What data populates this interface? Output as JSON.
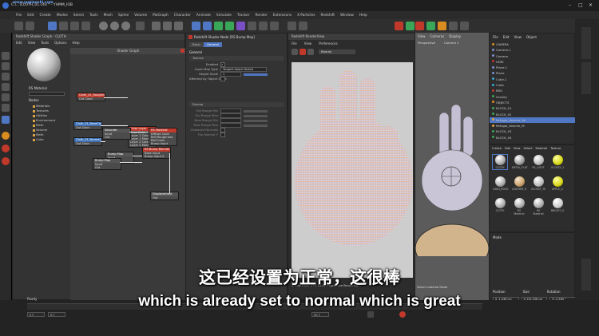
{
  "window": {
    "title": "C:\\...\\CLOTH_01.c4d * - YHMM_IOB",
    "watermark": "www.yugiaoshi.com",
    "node_space_label": "Node Space:",
    "node_space_value": "Current (Redshift)",
    "layout_label": "Layout:",
    "layout_value": "RS_S17 (User)"
  },
  "menu": [
    "File",
    "Edit",
    "Create",
    "Modes",
    "Select",
    "Tools",
    "Mesh",
    "Spline",
    "Volume",
    "MoGraph",
    "Character",
    "Animate",
    "Simulate",
    "Tracker",
    "Render",
    "Extensions",
    "X-Particles",
    "Redshift",
    "Window",
    "Help"
  ],
  "colors": {
    "accent": "#4f77c4",
    "selected_red": "#c0392b",
    "panel_bg": "#333333",
    "subtitle": "#ffffff"
  },
  "material_panel": {
    "title": "Redshift Shader Graph - CLOTH",
    "tabs": [
      "Edit",
      "View",
      "Tools",
      "Options",
      "Help"
    ],
    "material_name": "RS Material",
    "nodes_header": "Nodes",
    "tree": [
      "Materials",
      "Textures",
      "Utilities",
      "Environment",
      "Math",
      "Volume",
      "Math",
      "Color"
    ]
  },
  "shader_graph": {
    "title": "Shader Graph",
    "nodes": [
      {
        "title": "Cloth_01_Roughness.jpg",
        "rows": [
          "Out Color"
        ]
      },
      {
        "title": "Color Layer",
        "rows": [
          "Base Color",
          "Layer 1 Color",
          "Layer 1 Mask",
          "Layer 2 Color",
          "Layer 2 Mask"
        ]
      },
      {
        "title": "Cloth_01_BaseColor.jpg",
        "rows": [
          "Out Color"
        ]
      },
      {
        "title": "Saturate",
        "rows": [
          "Input",
          "Out"
        ]
      },
      {
        "title": "RS Material",
        "rows": [
          "Diffuse Color",
          "Refl Roughness",
          "Refl Color",
          "Bump Input"
        ]
      },
      {
        "title": "Cloth_01_Normal.jpg",
        "rows": [
          "Out Color"
        ]
      },
      {
        "title": "Bump Map",
        "rows": [
          "Input",
          "Out"
        ]
      },
      {
        "title": "RS Bump Blender",
        "rows": [
          "Base Input",
          "Bump Input 0"
        ]
      },
      {
        "title": "Bump Map",
        "rows": [
          "Input",
          "Out"
        ]
      },
      {
        "title": "Displacement",
        "rows": [
          "Out"
        ]
      }
    ]
  },
  "attributes": {
    "header": "Redshift Shader Node [RS Bump Map]",
    "tabs": [
      "Basic",
      "General"
    ],
    "section_general": "General",
    "section_texture": "Texture",
    "section_remap": "Remap",
    "rows": [
      {
        "label": "Enabled",
        "value": "✓"
      },
      {
        "label": "Input Map Type",
        "value": "Tangent-Space Normal"
      },
      {
        "label": "Height Scale",
        "value": "1"
      },
      {
        "label": "Affected by Object Scale",
        "value": ""
      }
    ],
    "remap_rows": [
      "Old Range Min",
      "Old Range Max",
      "New Range Min",
      "New Range Max",
      "Unbiased Normals",
      "Flip Normal Y"
    ]
  },
  "render_view": {
    "title": "Redshift RenderView",
    "tabs": [
      "File",
      "View",
      "Preferences"
    ],
    "aov": "Beauty",
    "status": "ShaderMode (FPS 13.6)   Progressive Rendering..."
  },
  "viewport": {
    "tabs": [
      "View",
      "Cameras",
      "Display"
    ],
    "mode": "Perspective",
    "camera": "Camera 1",
    "footer": "Select material Mode"
  },
  "objects": {
    "header_tabs": [
      "File",
      "Edit",
      "View",
      "Object"
    ],
    "items": [
      "CAMERA",
      "Camera.1",
      "Camera",
      "HDRI",
      "Plane.1",
      "Plane",
      "Cube.1",
      "Cube",
      "BRG",
      "Gravity",
      "OBJECTS",
      "BLOCK_01",
      "BLOCK_02",
      "Refugio_Volume_Ve",
      "Refugio_Volume_M",
      "BLOCK_03",
      "BLOCK_04"
    ]
  },
  "materials": {
    "tabs": [
      "Create",
      "Edit",
      "View",
      "Select",
      "Material",
      "Texture"
    ],
    "items": [
      "CLOTH",
      "METAL_FLAT",
      "RS_LIGHT",
      "GLOSSY_1",
      "USED_ROCK",
      "LEATHER_R",
      "GLOSSY_YE",
      "APPLE_G",
      "CLOTH",
      "RS Material",
      "RS Material",
      "BRIGHT_G"
    ]
  },
  "coords": {
    "headers": [
      "Position",
      "Size",
      "Rotation"
    ],
    "rows": [
      [
        "X -1.436 cm",
        "X 132.536 cm",
        "H -2.589 °"
      ],
      [
        "Y 1.624 cm",
        "Y 165.923 cm",
        "P 166.303 °"
      ],
      [
        "Z 12.43 cm",
        "Z 84.659 cm",
        "B -1.294 °"
      ]
    ],
    "mode": "Object (Rel)",
    "size_mode": "Size",
    "apply": "Apply"
  },
  "timeline": {
    "status": "Ready",
    "frame_start": "0 F",
    "frame_end": "90 F",
    "frame_current": "0 F"
  },
  "subtitles": {
    "chinese": "这已经设置为正常，这很棒",
    "english": "which is already set to normal which is great"
  }
}
